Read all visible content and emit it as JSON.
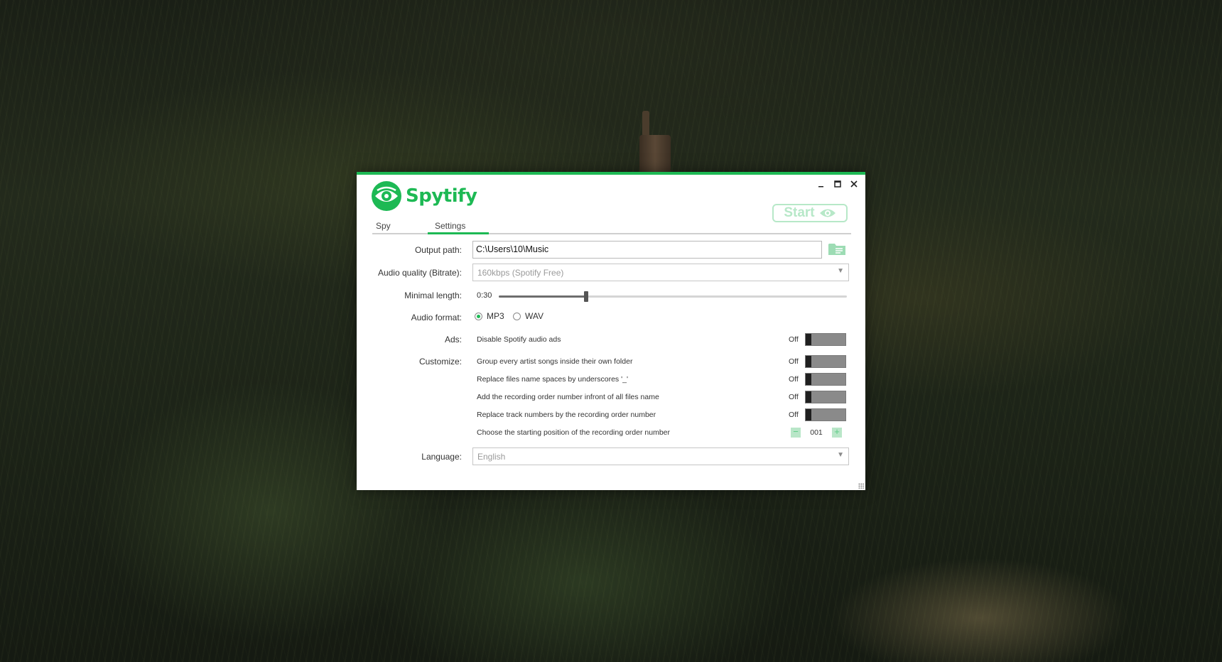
{
  "app": {
    "name": "Spytify",
    "brand_color": "#1db954"
  },
  "window_controls": [
    "minimize-icon",
    "maximize-icon",
    "close-icon"
  ],
  "start_button": {
    "label": "Start",
    "icon": "eye-icon"
  },
  "tabs": [
    {
      "label": "Spy",
      "active": false
    },
    {
      "label": "Settings",
      "active": true
    }
  ],
  "settings": {
    "output_path": {
      "label": "Output path:",
      "value": "C:\\Users\\10\\Music",
      "icon": "folder-icon"
    },
    "audio_quality": {
      "label": "Audio quality (Bitrate):",
      "value": "160kbps (Spotify Free)"
    },
    "minimal_length": {
      "label": "Minimal length:",
      "value": "0:30",
      "level": 0.25
    },
    "audio_format": {
      "label": "Audio format:",
      "options": [
        "MP3",
        "WAV"
      ],
      "selected": "MP3"
    },
    "ads": {
      "label": "Ads:",
      "option": "Disable Spotify audio ads",
      "state": "Off"
    },
    "customize": {
      "label": "Customize:",
      "options": [
        {
          "text": "Group every artist songs inside their own folder",
          "state": "Off"
        },
        {
          "text": "Replace files name spaces by underscores '_'",
          "state": "Off"
        },
        {
          "text": "Add the recording order number infront of all files name",
          "state": "Off"
        },
        {
          "text": "Replace track numbers by the recording order number",
          "state": "Off"
        }
      ],
      "start_position": {
        "text": "Choose the starting position of the recording order number",
        "value": "001",
        "minus": "−",
        "plus": "+"
      }
    },
    "language": {
      "label": "Language:",
      "value": "English"
    }
  }
}
